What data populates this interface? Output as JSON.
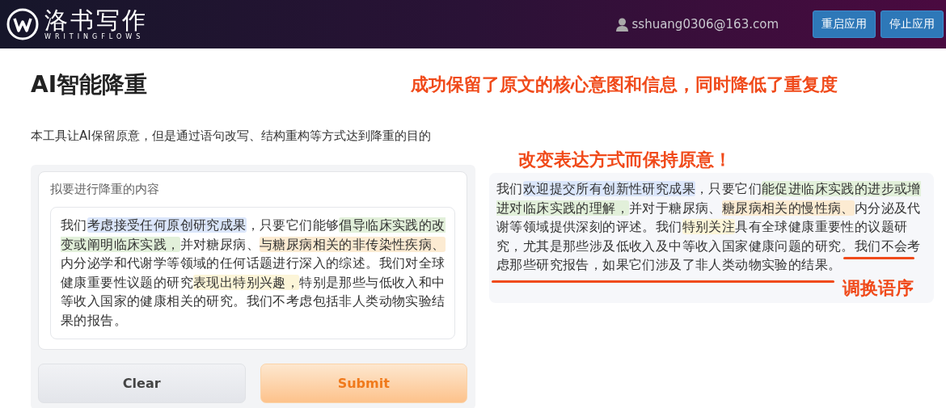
{
  "header": {
    "brand": "洛书写作",
    "brand_sub": "WRITINGFLOWS",
    "user": "sshuang0306@163.com",
    "buttons": [
      "重启应用",
      "停止应用"
    ]
  },
  "title": "AI智能降重",
  "description": "本工具让AI保留原意，但是通过语句改写、结构重构等方式达到降重的目的",
  "input": {
    "label": "拟要进行降重的内容",
    "segments": [
      {
        "text": "我们"
      },
      {
        "text": "考虑接受任何原创研究成果",
        "color": "#dbe6fb"
      },
      {
        "text": "，只要它们能够"
      },
      {
        "text": "倡导临床实践的改变或阐明临床实践，",
        "color": "#e2f0da"
      },
      {
        "text": "并对糖尿病、"
      },
      {
        "text": "与糖尿病相关的非传染性疾病、",
        "color": "#fcebd2"
      },
      {
        "text": "内分泌学和代谢学等领域的任何话题进行深入的综述。我们对全球健康重要性议题的研究"
      },
      {
        "text": "表现出特别兴趣，",
        "color": "#fcf5d8"
      },
      {
        "text": "特别是那些与低收入和中等收入国家的健康相关的研究。我们不考虑包括非人类动物实验结果的报告。"
      }
    ]
  },
  "actions": [
    "Clear",
    "Submit"
  ],
  "output": {
    "segments": [
      {
        "text": "我们"
      },
      {
        "text": "欢迎提交所有创新性研究成果",
        "color": "#dbe6fb"
      },
      {
        "text": "，只要它们"
      },
      {
        "text": "能促进临床实践的进步或增进对临床实践的理解，",
        "color": "#e2f0da"
      },
      {
        "text": "并对于糖尿病、"
      },
      {
        "text": "糖尿病相关的慢性病、",
        "color": "#fcebd2"
      },
      {
        "text": "内分泌及代谢等领域提供深刻的评述。我们"
      },
      {
        "text": "特别关注",
        "color": "#fcf5d8"
      },
      {
        "text": "具有全球健康重要性的议题研究，尤其是那些涉及低收入及中等收入国家健康问题的研究。我们不会考虑那些研究报告，如果它们涉及了非人类动物实验的结果。"
      }
    ]
  },
  "annotations": [
    "成功保留了原文的核心意图和信息，同时降低了重复度",
    "改变表达方式而保持原意！",
    "调换语序"
  ]
}
